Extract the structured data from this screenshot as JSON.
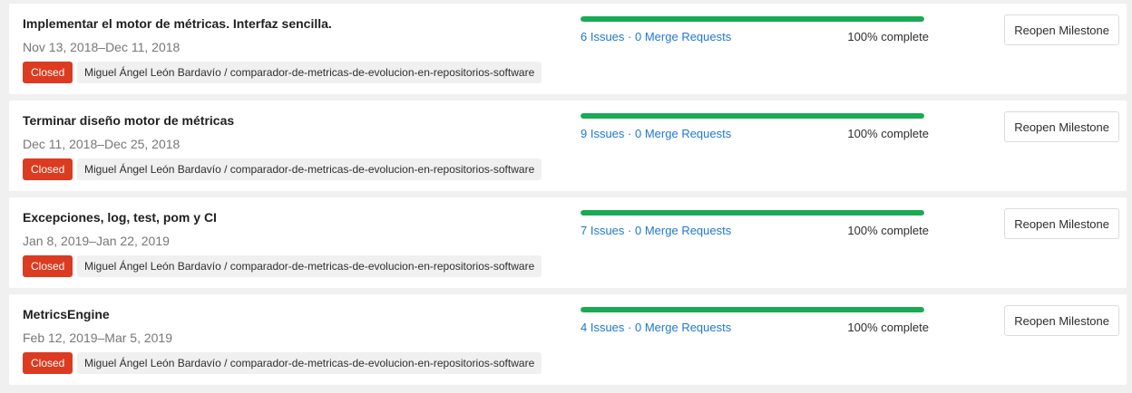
{
  "milestones": [
    {
      "title": "Implementar el motor de métricas. Interfaz sencilla.",
      "dates": "Nov 13, 2018–Dec 11, 2018",
      "status": "Closed",
      "project": "Miguel Ángel León Bardavío / comparador-de-metricas-de-evolucion-en-repositorios-software",
      "issues": "6 Issues",
      "separator": "·",
      "merge_requests": "0 Merge Requests",
      "percent": 100,
      "complete_label": "100% complete",
      "action": "Reopen Milestone"
    },
    {
      "title": "Terminar diseño motor de métricas",
      "dates": "Dec 11, 2018–Dec 25, 2018",
      "status": "Closed",
      "project": "Miguel Ángel León Bardavío / comparador-de-metricas-de-evolucion-en-repositorios-software",
      "issues": "9 Issues",
      "separator": "·",
      "merge_requests": "0 Merge Requests",
      "percent": 100,
      "complete_label": "100% complete",
      "action": "Reopen Milestone"
    },
    {
      "title": "Excepciones, log, test, pom y CI",
      "dates": "Jan 8, 2019–Jan 22, 2019",
      "status": "Closed",
      "project": "Miguel Ángel León Bardavío / comparador-de-metricas-de-evolucion-en-repositorios-software",
      "issues": "7 Issues",
      "separator": "·",
      "merge_requests": "0 Merge Requests",
      "percent": 100,
      "complete_label": "100% complete",
      "action": "Reopen Milestone"
    },
    {
      "title": "MetricsEngine",
      "dates": "Feb 12, 2019–Mar 5, 2019",
      "status": "Closed",
      "project": "Miguel Ángel León Bardavío / comparador-de-metricas-de-evolucion-en-repositorios-software",
      "issues": "4 Issues",
      "separator": "·",
      "merge_requests": "0 Merge Requests",
      "percent": 100,
      "complete_label": "100% complete",
      "action": "Reopen Milestone"
    }
  ],
  "colors": {
    "closed_badge": "#db3b21",
    "progress_fill": "#1aaa55",
    "link": "#1f78d1"
  }
}
